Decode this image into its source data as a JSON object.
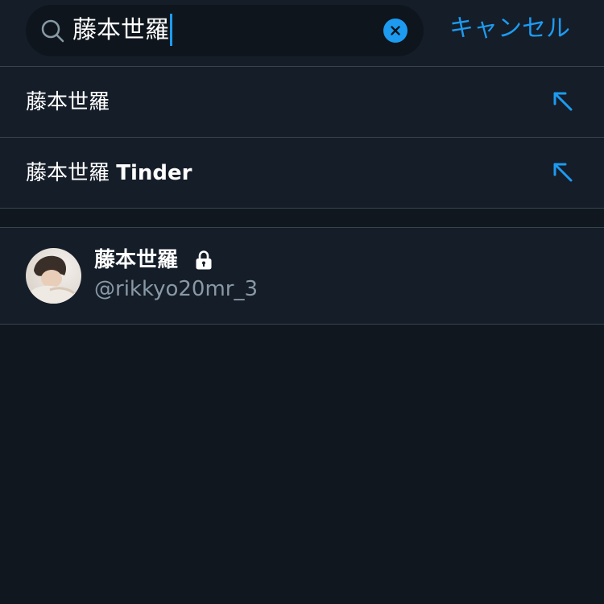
{
  "search": {
    "query": "藤本世羅",
    "cancel_label": "キャンセル"
  },
  "suggestions": [
    {
      "plain": "藤本世羅",
      "bold": ""
    },
    {
      "plain": "藤本世羅 ",
      "bold": "Tinder"
    }
  ],
  "user_result": {
    "name": "藤本世羅",
    "handle": "@rikkyo20mr_3",
    "protected": true
  },
  "colors": {
    "background": "#11171f",
    "surface": "#151d28",
    "accent": "#1d9bf0",
    "secondary_text": "#8899a6",
    "divider": "#38444d"
  },
  "icons": [
    "search-icon",
    "clear-icon",
    "arrow-up-left-icon",
    "lock-icon"
  ]
}
